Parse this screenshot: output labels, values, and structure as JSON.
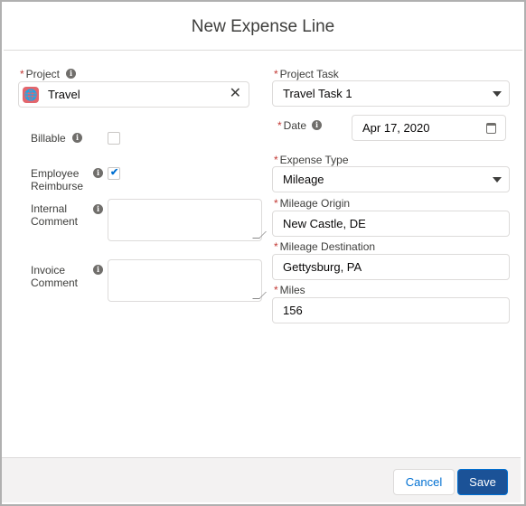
{
  "dialog": {
    "title": "New Expense Line"
  },
  "form": {
    "project": {
      "label": "Project",
      "value": "Travel",
      "icon": "globe-icon"
    },
    "billable": {
      "label": "Billable",
      "checked": false
    },
    "employee_reimburse": {
      "label_line1": "Employee",
      "label_line2": "Reimburse",
      "checked": true
    },
    "internal_comment": {
      "label_line1": "Internal",
      "label_line2": "Comment",
      "value": ""
    },
    "invoice_comment": {
      "label_line1": "Invoice",
      "label_line2": "Comment",
      "value": ""
    },
    "project_task": {
      "label": "Project Task",
      "value": "Travel Task 1"
    },
    "date": {
      "label": "Date",
      "value": "Apr 17, 2020"
    },
    "expense_type": {
      "label": "Expense Type",
      "value": "Mileage"
    },
    "mileage_origin": {
      "label": "Mileage Origin",
      "value": "New Castle, DE"
    },
    "mileage_destination": {
      "label": "Mileage Destination",
      "value": "Gettysburg, PA"
    },
    "miles": {
      "label": "Miles",
      "value": "156"
    }
  },
  "footer": {
    "cancel_label": "Cancel",
    "save_label": "Save"
  },
  "colors": {
    "brand": "#1b5297",
    "required": "#c23934",
    "link": "#0070d2"
  }
}
